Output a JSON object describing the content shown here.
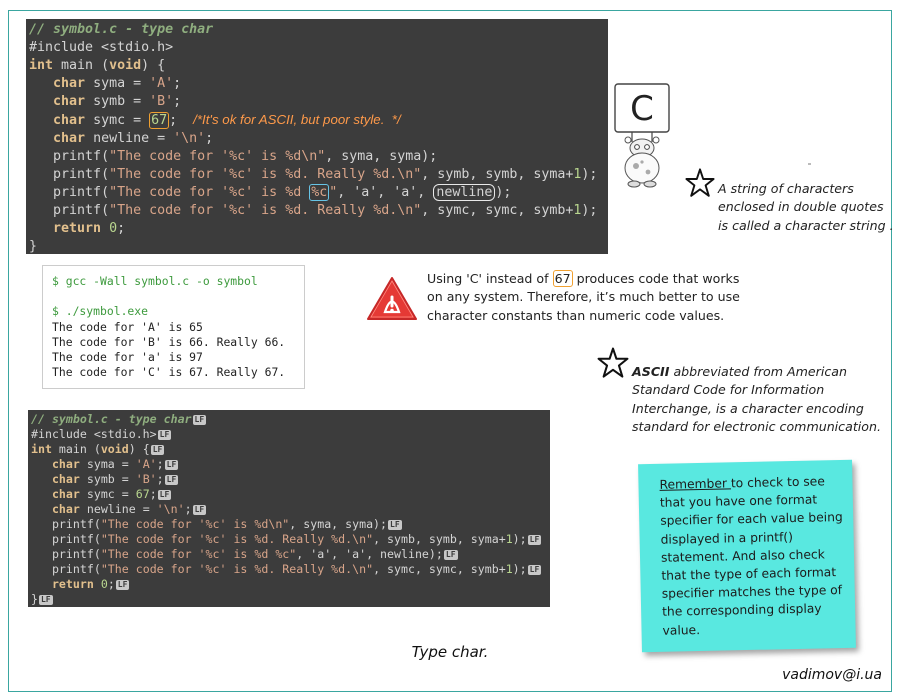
{
  "code_top": {
    "comment": "// symbol.c - type char",
    "include": "#include <stdio.h>",
    "main_kw": "int",
    "main_rest": " main (",
    "void": "void",
    "main_end": ") {",
    "decl_a_kw": "char",
    "decl_a": " syma = ",
    "decl_a_val": "'A'",
    "decl_b_kw": "char",
    "decl_b": " symb = ",
    "decl_b_val": "'B'",
    "decl_c_kw": "char",
    "decl_c": " symc = ",
    "decl_c_val": "67",
    "decl_c_comment": "/*It's ok for ASCII, but poor style.  */",
    "decl_n_kw": "char",
    "decl_n": " newline = ",
    "decl_n_val": "'\\n'",
    "p1_fn": "printf(",
    "p1_str": "\"The code for '%c' is %d\\n\"",
    "p1_rest": ", syma, syma);",
    "p2_fn": "printf(",
    "p2_str": "\"The code for '%c' is %d. Really %d.\\n\"",
    "p2_rest": ", symb, symb, syma+",
    "p2_num": "1",
    "p2_end": ");",
    "p3_fn": "printf(",
    "p3_str_a": "\"The code for '%c' is %d ",
    "p3_str_box": "%c",
    "p3_str_b": "\"",
    "p3_rest": ", 'a', 'a', ",
    "p3_box": "newline",
    "p3_end": ");",
    "p4_fn": "printf(",
    "p4_str": "\"The code for '%c' is %d. Really %d.\\n\"",
    "p4_rest": ", symc, symc, symb+",
    "p4_num": "1",
    "p4_end": ");",
    "ret_kw": "return",
    "ret_val": "0",
    "close": "}"
  },
  "terminal": {
    "cmd1": "$ gcc -Wall symbol.c -o symbol",
    "cmd2": "$ ./symbol.exe",
    "out1": "The code for 'A' is 65",
    "out2": "The code for 'B' is 66. Really 66.",
    "out3": "The code for 'a' is 97",
    "out4": "The code for 'C' is 67. Really 67."
  },
  "code_bottom": {
    "l1": "// symbol.c - type char",
    "l2": "#include <stdio.h>",
    "l3_kw": "int",
    "l3": " main (",
    "l3_void": "void",
    "l3_end": ") {",
    "l4_kw": "char",
    "l4": " syma = ",
    "l4_val": "'A'",
    "l5_kw": "char",
    "l5": " symb = ",
    "l5_val": "'B'",
    "l6_kw": "char",
    "l6": " symc = ",
    "l6_val": "67",
    "l7_kw": "char",
    "l7": " newline = ",
    "l7_val": "'\\n'",
    "l8_fn": "printf(",
    "l8_str": "\"The code for '%c' is %d\\n\"",
    "l8_rest": ", syma, syma);",
    "l9_fn": "printf(",
    "l9_str": "\"The code for '%c' is %d. Really %d.\\n\"",
    "l9_rest": ", symb, symb, syma+",
    "l9_num": "1",
    "l9_end": ");",
    "l10_fn": "printf(",
    "l10_str": "\"The code for '%c' is %d %c\"",
    "l10_rest": ", 'a', 'a', newline);",
    "l11_fn": "printf(",
    "l11_str": "\"The code for '%c' is %d. Really %d.\\n\"",
    "l11_rest": ", symc, symc, symb+",
    "l11_num": "1",
    "l11_end": ");",
    "l12_kw": "return",
    "l12_val": "0",
    "l13": "}",
    "lf": "LF"
  },
  "notes": {
    "string_note": "A string of characters enclosed in double quotes is called a character string .",
    "char_note_a": "Using 'C' instead of ",
    "char_note_num": "67",
    "char_note_b": " produces code that works on any system. Therefore, it’s much better to use character constants than numeric code values.",
    "ascii_bold": "ASCII",
    "ascii_rest": " abbreviated from American Standard Code for Information Interchange, is a character encoding standard for electronic communication."
  },
  "sticky": {
    "lead": "Remember ",
    "body": "to check to see that you have one format specifier for each value being displayed in a printf() statement. And also check that the type of each format specifier matches the type of the corresponding display value."
  },
  "mascot_letter": "C",
  "caption": "Type char.",
  "email": "vadimov@i.ua",
  "icons": {
    "star": "star-icon",
    "warning": "warning-icon",
    "mascot": "mascot-icon"
  },
  "colors": {
    "accent": "#3aa6a0",
    "sticky": "#59e8e0",
    "warning": "#e53935",
    "highlight": "#f0a030"
  }
}
